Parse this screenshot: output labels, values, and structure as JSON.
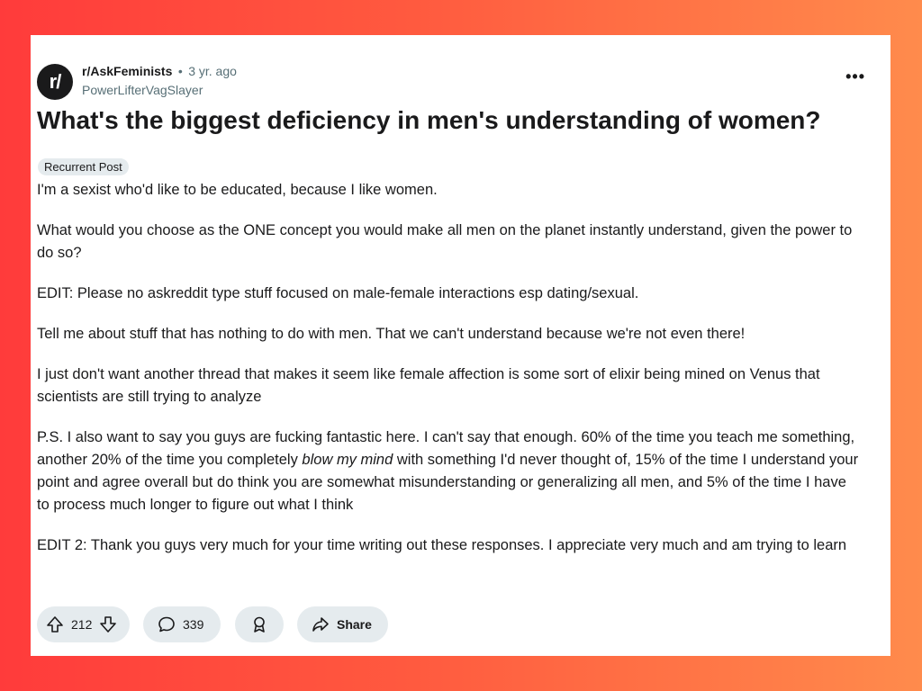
{
  "post": {
    "subreddit": "r/AskFeminists",
    "separator": "•",
    "age": "3 yr. ago",
    "author": "PowerLifterVagSlayer",
    "avatar_text": "r/",
    "more_label": "•••",
    "title": "What's the biggest deficiency in men's understanding of women?",
    "flair": "Recurrent Post",
    "body": {
      "p1": "I'm a sexist who'd like to be educated, because I like women.",
      "p2": "What would you choose as the ONE concept you would make all men on the planet instantly understand, given the power to do so?",
      "p3": "EDIT: Please no askreddit type stuff focused on male-female interactions esp dating/sexual.",
      "p4": "Tell me about stuff that has nothing to do with men. That we can't understand because we're not even there!",
      "p5": "I just don't want another thread that makes it seem like female affection is some sort of elixir being mined on Venus that scientists are still trying to analyze",
      "p6_a": "P.S. I also want to say you guys are fucking fantastic here. I can't say that enough. 60% of the time you teach me something, another 20% of the time you completely ",
      "p6_em": "blow my mind",
      "p6_b": " with something I'd never thought of, 15% of the time I understand your point and agree overall but do think you are somewhat misunderstanding or generalizing all men, and 5% of the time I have to process much longer to figure out what I think",
      "p7": "EDIT 2: Thank you guys very much for your time writing out these responses. I appreciate very much and am trying to learn"
    }
  },
  "actions": {
    "votes": "212",
    "comments": "339",
    "share_label": "Share"
  },
  "icons": {
    "upvote": "upvote-icon",
    "downvote": "downvote-icon",
    "comment": "comment-icon",
    "award": "award-icon",
    "share": "share-icon",
    "more": "more-options-icon"
  },
  "colors": {
    "background_gradient_start": "#ff3b3b",
    "background_gradient_end": "#ff8b4c",
    "card": "#ffffff",
    "pill": "#e5ebee",
    "muted_text": "#576f76"
  }
}
